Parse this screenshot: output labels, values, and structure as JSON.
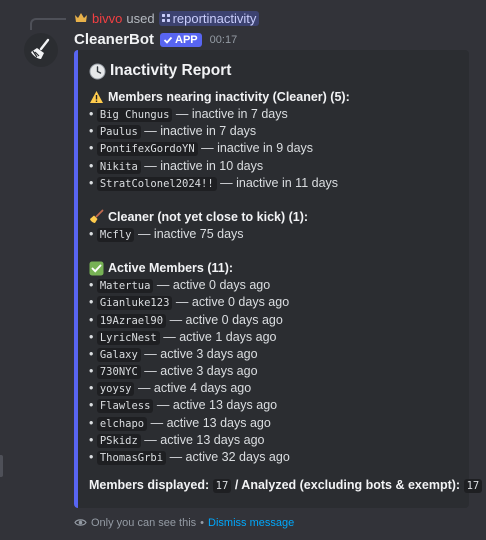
{
  "reply": {
    "user": "bivvo",
    "verb": "used",
    "command": "reportinactivity"
  },
  "message": {
    "username": "CleanerBot",
    "badge": "APP",
    "timestamp": "00:17"
  },
  "embed": {
    "title": "Inactivity Report",
    "accent_color": "#5865f2",
    "nearing": {
      "title": "Members nearing inactivity (Cleaner) (5):",
      "items": [
        {
          "name": "Big Chungus",
          "status": "— inactive in 7 days"
        },
        {
          "name": "Paulus",
          "status": "— inactive in 7 days"
        },
        {
          "name": "PontifexGordoYN",
          "status": "— inactive in 9 days"
        },
        {
          "name": "Nikita",
          "status": "— inactive in 10 days"
        },
        {
          "name": "StratColonel2024!!",
          "status": "— inactive in 11 days"
        }
      ]
    },
    "cleaner": {
      "title": "Cleaner (not yet close to kick) (1):",
      "items": [
        {
          "name": "Mcfly",
          "status": "— inactive 75 days"
        }
      ]
    },
    "active": {
      "title": "Active Members (11):",
      "items": [
        {
          "name": "Matertua",
          "status": "— active 0 days ago"
        },
        {
          "name": "Gianluke123",
          "status": "— active 0 days ago"
        },
        {
          "name": "19Azrael90",
          "status": "— active 0 days ago"
        },
        {
          "name": "LyricNest",
          "status": "— active 1 days ago"
        },
        {
          "name": "Galaxy",
          "status": "— active 3 days ago"
        },
        {
          "name": "730NYC",
          "status": "— active 3 days ago"
        },
        {
          "name": "yoysy",
          "status": "— active 4 days ago"
        },
        {
          "name": "Flawless",
          "status": "— active 13 days ago"
        },
        {
          "name": "elchapo",
          "status": "— active 13 days ago"
        },
        {
          "name": "PSkidz",
          "status": "— active 13 days ago"
        },
        {
          "name": "ThomasGrbi",
          "status": "— active 32 days ago"
        }
      ]
    },
    "footer": {
      "label_displayed": "Members displayed:",
      "displayed": "17",
      "label_analyzed": "/ Analyzed (excluding bots & exempt):",
      "analyzed": "17"
    }
  },
  "ephemeral": {
    "notice": "Only you can see this",
    "separator": "•",
    "dismiss": "Dismiss message"
  }
}
